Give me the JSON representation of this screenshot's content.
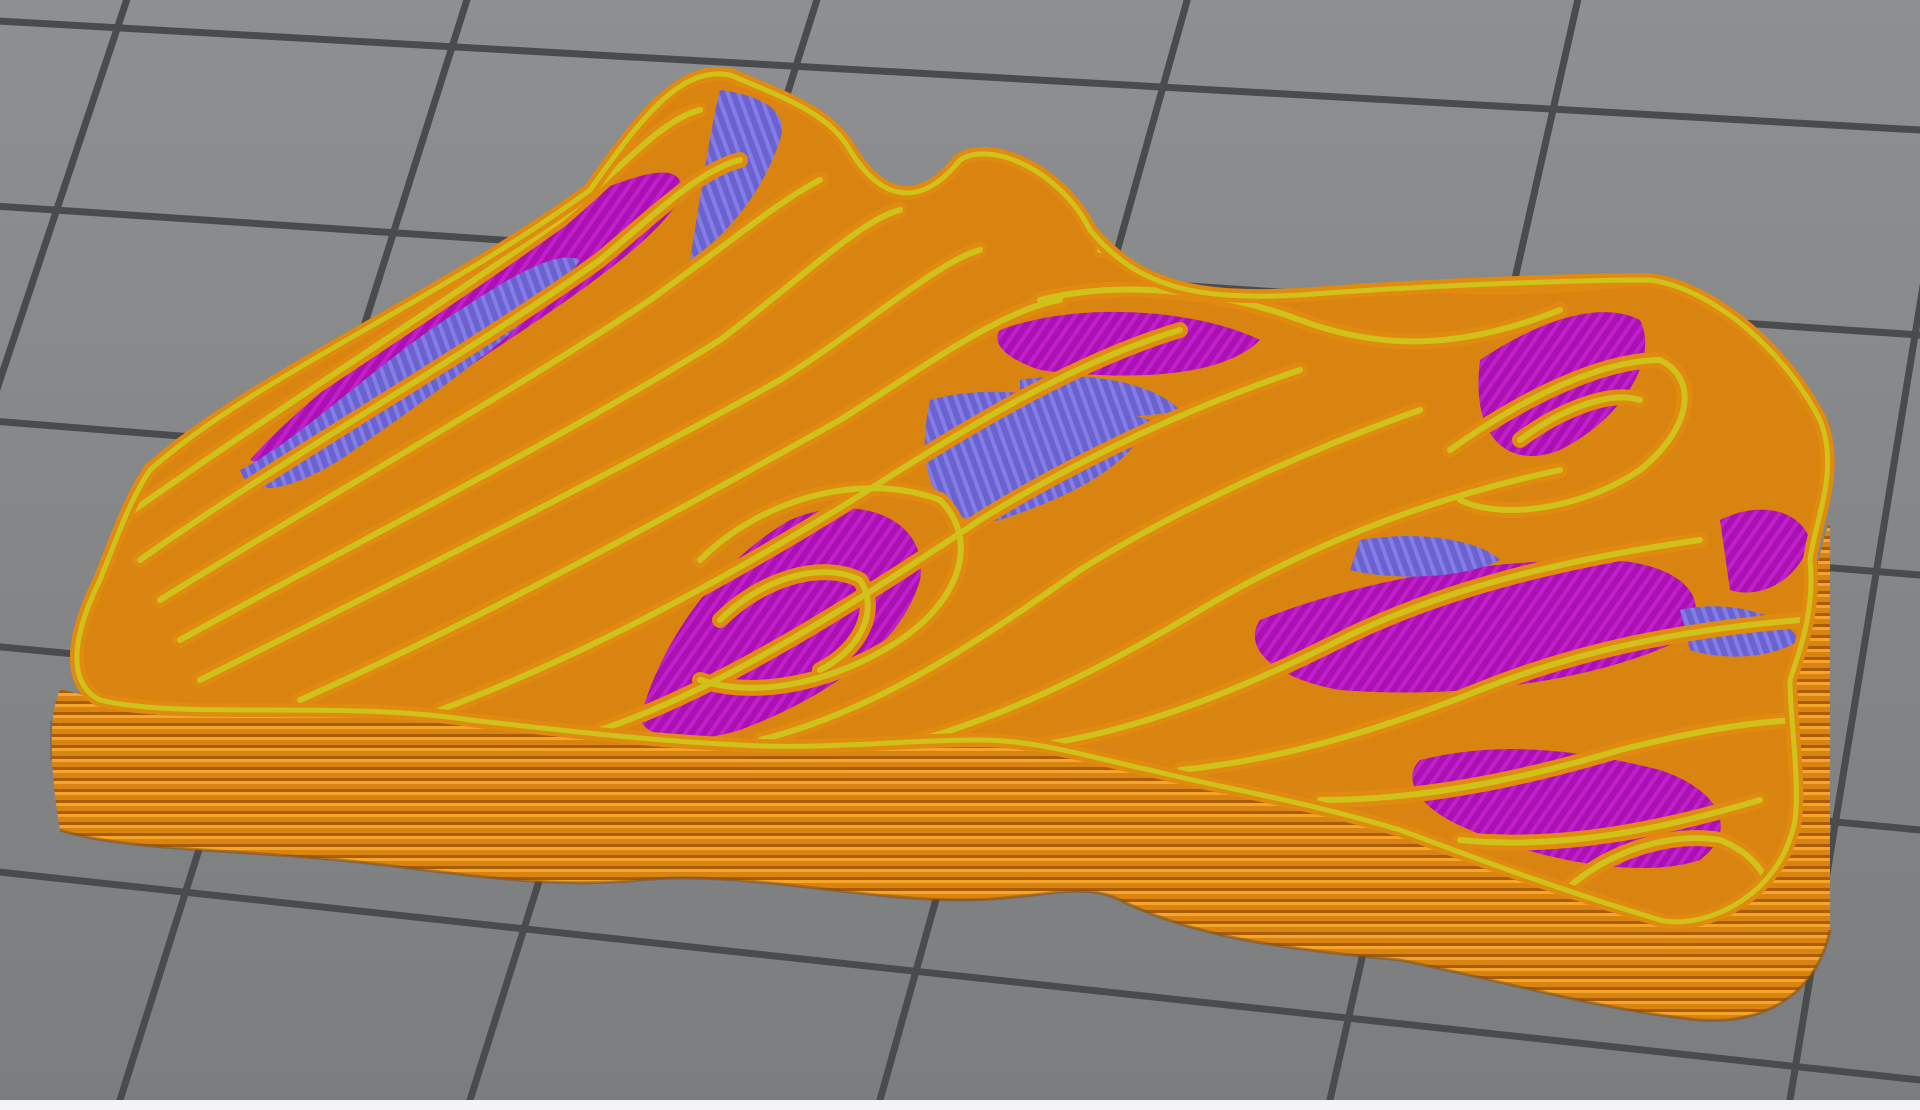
{
  "viewport": {
    "view": "slicer-preview",
    "bed_color": "#858789",
    "grid_line_color": "#4a4b4d",
    "background_strip_color": "#f3f3f5"
  },
  "model": {
    "feature_colors": {
      "perimeter": "#e08a10",
      "external_perimeter": "#cfc21a",
      "solid_infill": "#b012b8",
      "top_solid_infill": "#7068d6"
    }
  }
}
